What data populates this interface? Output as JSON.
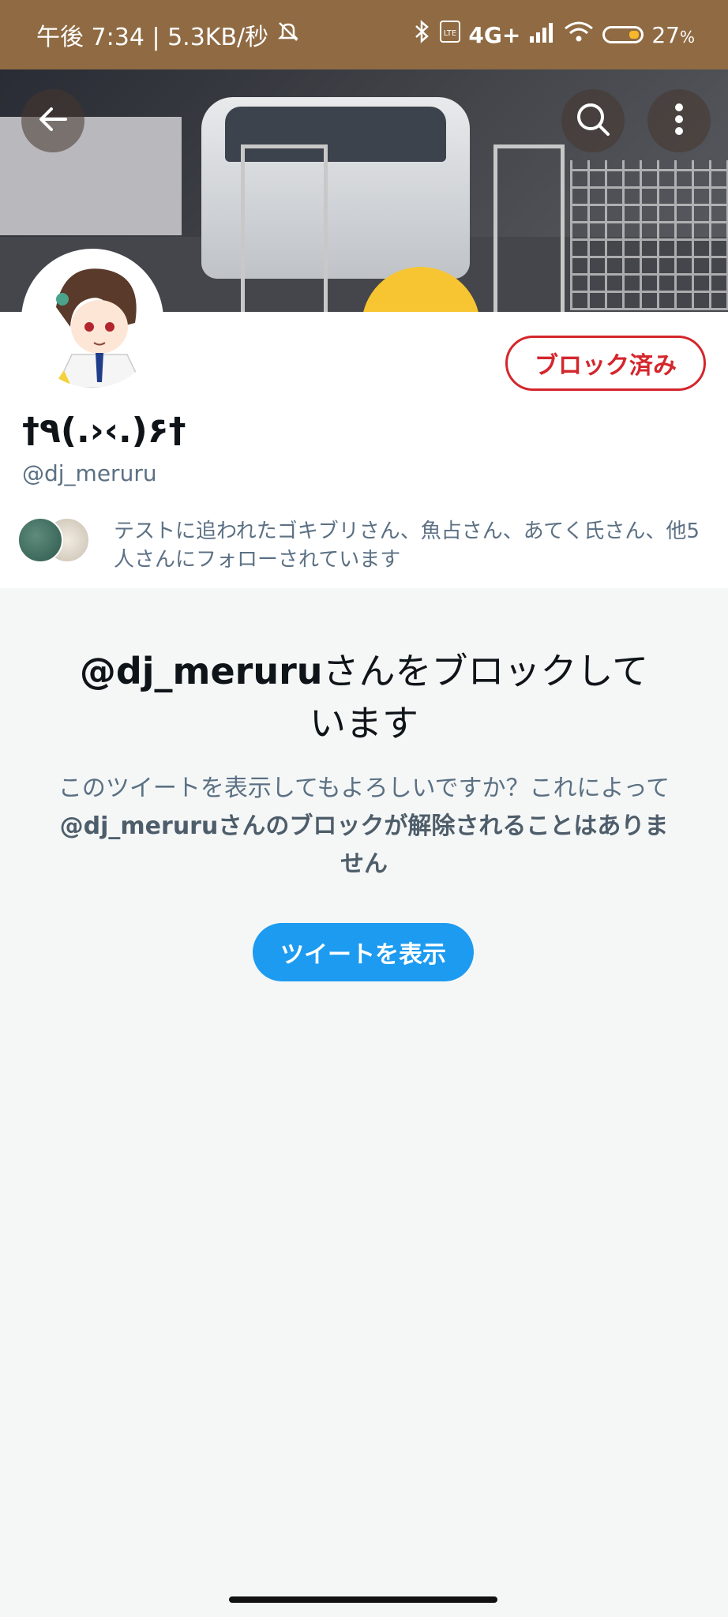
{
  "status_bar": {
    "time_info": "午後 7:34 | 5.3KB/秒",
    "network": "4G+",
    "battery": "27",
    "battery_unit": "%"
  },
  "icons": {
    "back": "arrow-left-icon",
    "search": "search-icon",
    "more": "more-vertical-icon"
  },
  "profile": {
    "display_name": "†٩(.›‹.)۶†",
    "handle": "@dj_meruru",
    "blocked_button_label": "ブロック済み",
    "followed_by_text": "テストに追われたゴキブリさん、魚占さん、あてく氏さん、他5人さんにフォローされています"
  },
  "blocked_notice": {
    "title_handle": "@dj_meruru",
    "title_rest": "さんをブロックしています",
    "desc_line1": "このツイートを表示してもよろしいですか？これによって",
    "desc_handle": "@dj_meruru",
    "desc_rest": "さんのブロックが解除されることはありません",
    "show_button_label": "ツイートを表示"
  },
  "colors": {
    "status_bar": "#8f6a42",
    "blocked_red": "#d4262c",
    "twitter_blue": "#1d9bf0",
    "secondary_text": "#5b7083"
  }
}
